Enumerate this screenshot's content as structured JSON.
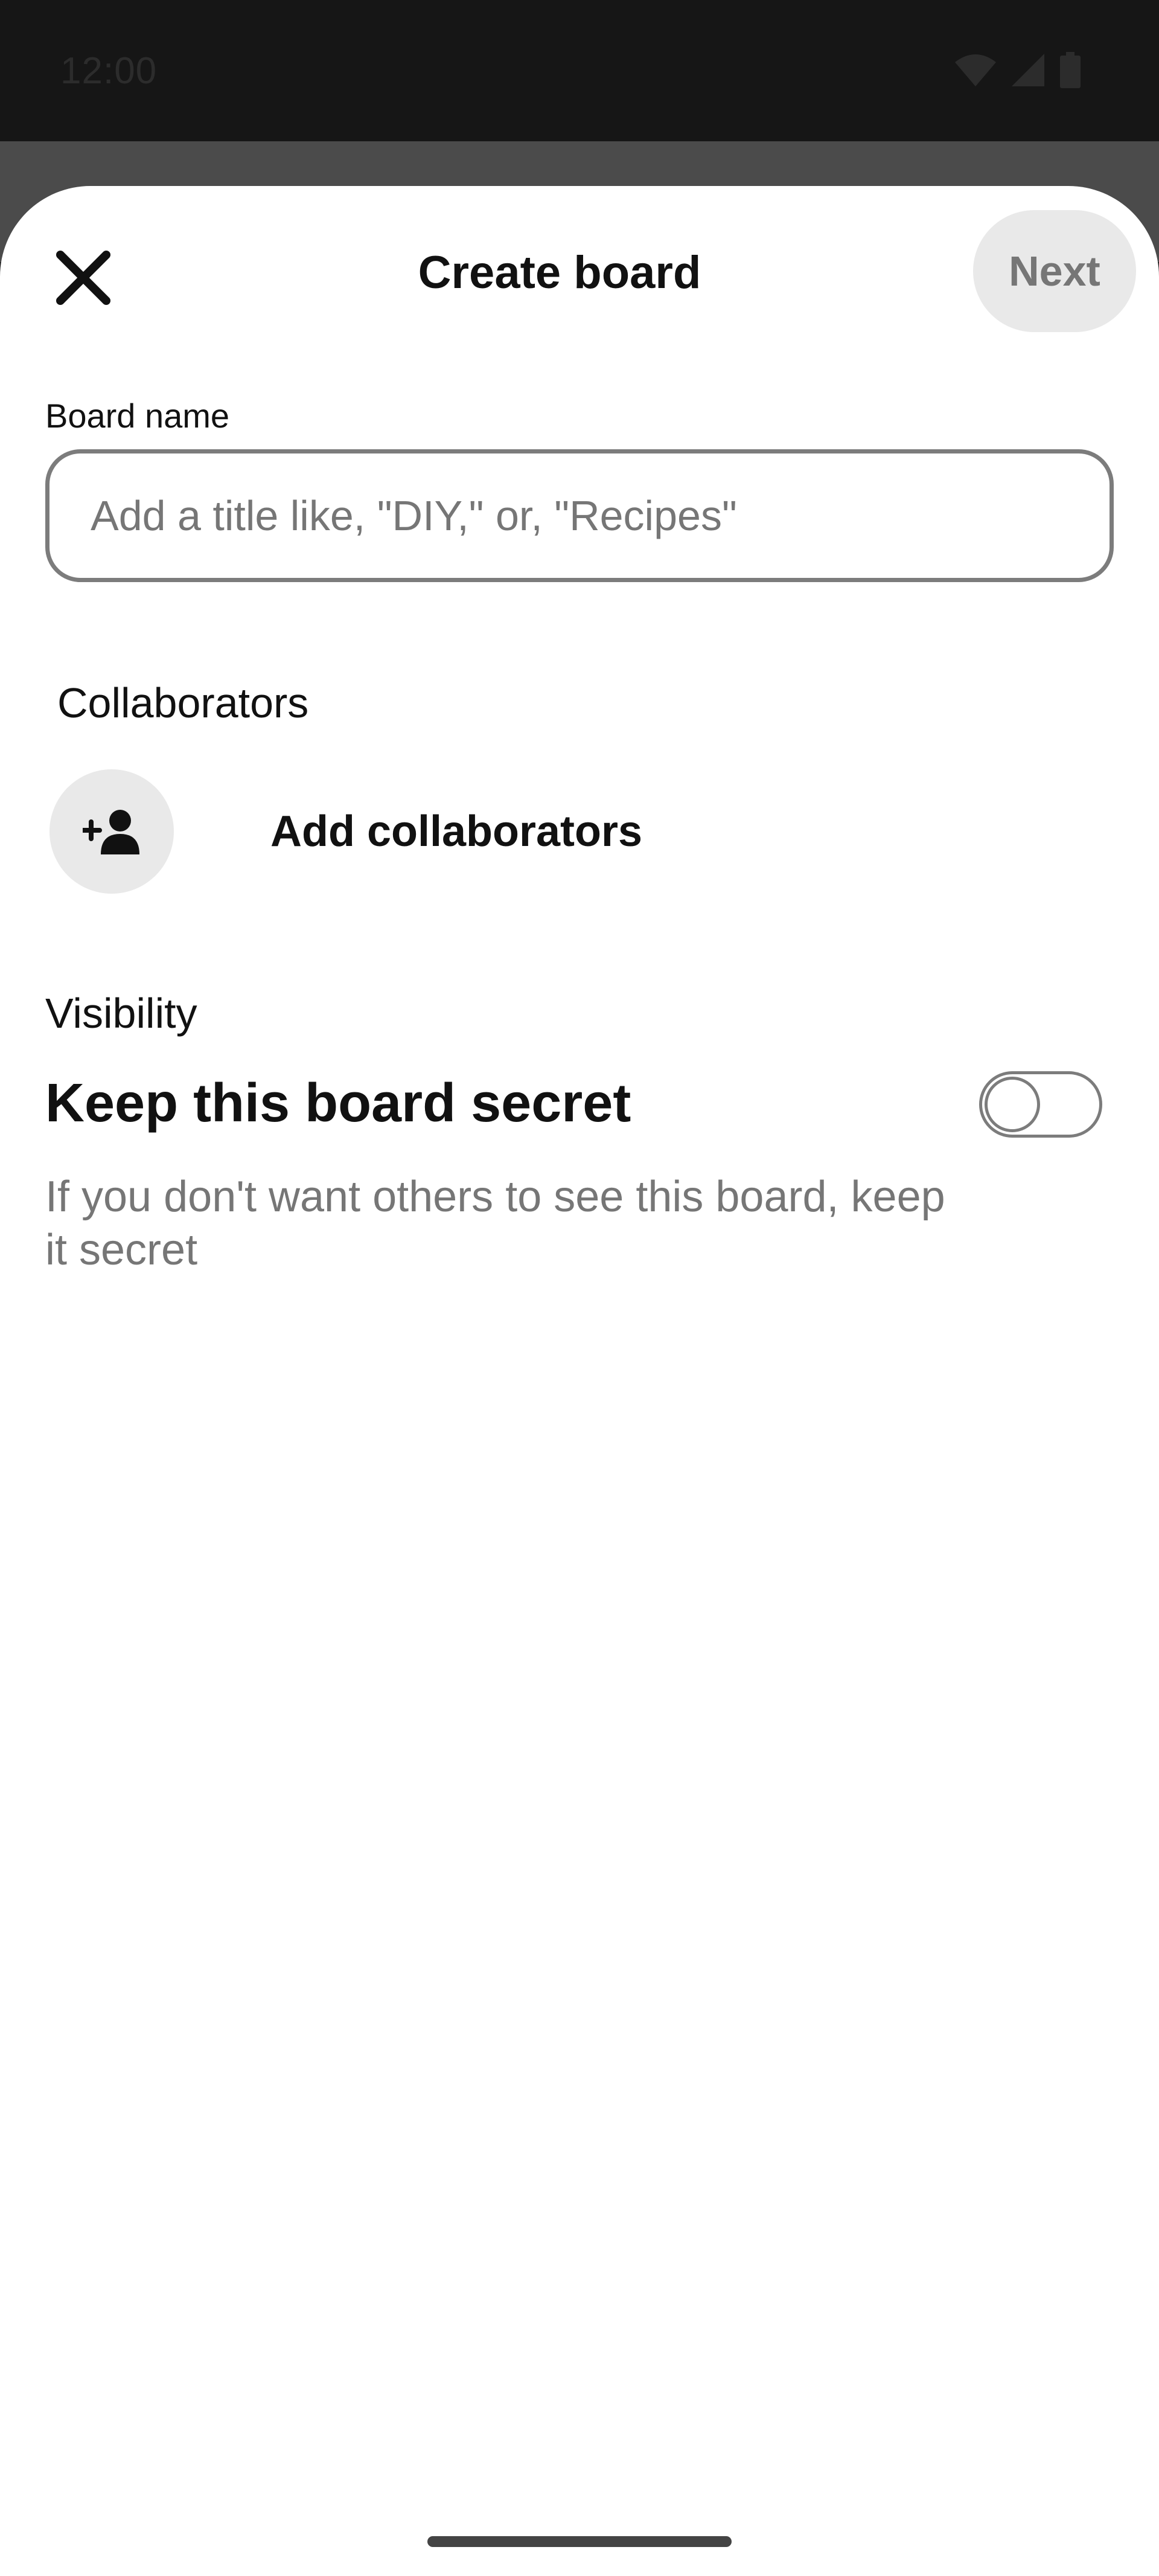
{
  "status_bar": {
    "time": "12:00",
    "icons": [
      "wifi-icon",
      "signal-icon",
      "battery-icon"
    ]
  },
  "header": {
    "close_icon": "close-icon",
    "title": "Create board",
    "next_label": "Next"
  },
  "board_name": {
    "label": "Board name",
    "value": "",
    "placeholder": "Add a title like, \"DIY,\" or, \"Recipes\""
  },
  "collaborators": {
    "section_label": "Collaborators",
    "add_label": "Add collaborators",
    "icon": "add-person-icon"
  },
  "visibility": {
    "section_label": "Visibility",
    "secret_title": "Keep this board secret",
    "secret_description": "If you don't want others to see this board, keep it secret",
    "secret_enabled": false
  },
  "colors": {
    "sheet_background": "#ffffff",
    "text_primary": "#111111",
    "text_secondary": "#767676",
    "button_disabled_bg": "#e9e9e9",
    "border": "#7c7c7c"
  }
}
